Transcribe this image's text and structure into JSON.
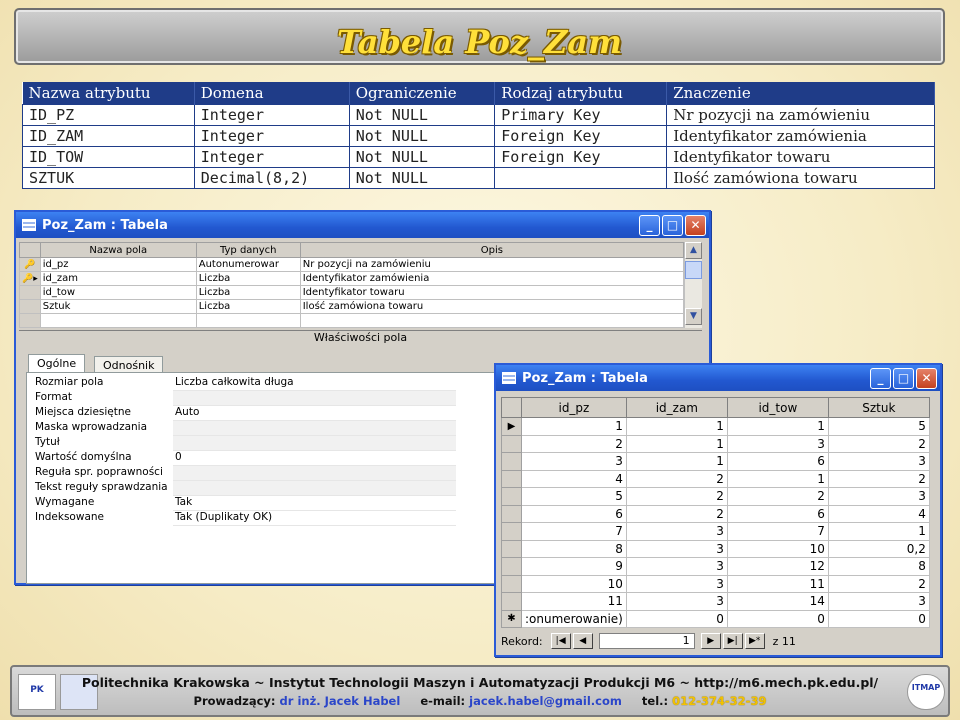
{
  "slide": {
    "title": "Tabela Poz_Zam"
  },
  "definition": {
    "headers": [
      "Nazwa atrybutu",
      "Domena",
      "Ograniczenie",
      "Rodzaj atrybutu",
      "Znaczenie"
    ],
    "rows": [
      [
        "ID_PZ",
        "Integer",
        "Not NULL",
        "Primary Key",
        "Nr pozycji na zamówieniu"
      ],
      [
        "ID_ZAM",
        "Integer",
        "Not NULL",
        "Foreign Key",
        "Identyfikator zamówienia"
      ],
      [
        "ID_TOW",
        "Integer",
        "Not NULL",
        "Foreign Key",
        "Identyfikator towaru"
      ],
      [
        "SZTUK",
        "Decimal(8,2)",
        "Not NULL",
        "",
        "Ilość zamówiona towaru"
      ]
    ]
  },
  "design_window": {
    "title": "Poz_Zam : Tabela",
    "headers": [
      "Nazwa pola",
      "Typ danych",
      "Opis"
    ],
    "rows": [
      {
        "marker": "🔑",
        "name": "id_pz",
        "type": "Autonumerowar",
        "desc": "Nr pozycji na zamówieniu"
      },
      {
        "marker": "🔑▸",
        "name": "id_zam",
        "type": "Liczba",
        "desc": "Identyfikator zamówienia"
      },
      {
        "marker": "",
        "name": "id_tow",
        "type": "Liczba",
        "desc": "Identyfikator towaru"
      },
      {
        "marker": "",
        "name": "Sztuk",
        "type": "Liczba",
        "desc": "Ilość zamówiona towaru"
      },
      {
        "marker": "",
        "name": "",
        "type": "",
        "desc": ""
      }
    ],
    "properties_label": "Właściwości pola",
    "tabs": [
      "Ogólne",
      "Odnośnik"
    ],
    "properties": [
      {
        "k": "Rozmiar pola",
        "v": "Liczba całkowita długa"
      },
      {
        "k": "Format",
        "v": ""
      },
      {
        "k": "Miejsca dziesiętne",
        "v": "Auto"
      },
      {
        "k": "Maska wprowadzania",
        "v": ""
      },
      {
        "k": "Tytuł",
        "v": ""
      },
      {
        "k": "Wartość domyślna",
        "v": "0"
      },
      {
        "k": "Reguła spr. poprawności",
        "v": ""
      },
      {
        "k": "Tekst reguły sprawdzania",
        "v": ""
      },
      {
        "k": "Wymagane",
        "v": "Tak"
      },
      {
        "k": "Indeksowane",
        "v": "Tak (Duplikaty OK)"
      }
    ]
  },
  "data_window": {
    "title": "Poz_Zam : Tabela",
    "headers": [
      "id_pz",
      "id_zam",
      "id_tow",
      "Sztuk"
    ],
    "rows": [
      [
        "1",
        "1",
        "1",
        "5"
      ],
      [
        "2",
        "1",
        "3",
        "2"
      ],
      [
        "3",
        "1",
        "6",
        "3"
      ],
      [
        "4",
        "2",
        "1",
        "2"
      ],
      [
        "5",
        "2",
        "2",
        "3"
      ],
      [
        "6",
        "2",
        "6",
        "4"
      ],
      [
        "7",
        "3",
        "7",
        "1"
      ],
      [
        "8",
        "3",
        "10",
        "0,2"
      ],
      [
        "9",
        "3",
        "12",
        "8"
      ],
      [
        "10",
        "3",
        "11",
        "2"
      ],
      [
        "11",
        "3",
        "14",
        "3"
      ],
      [
        ":onumerowanie)",
        "0",
        "0",
        "0"
      ]
    ],
    "record_label": "Rekord:",
    "record_value": "1",
    "record_total": "z  11"
  },
  "footer": {
    "line1": "Politechnika Krakowska   ~   Instytut Technologii Maszyn i Automatyzacji Produkcji M6   ~   http://m6.mech.pk.edu.pl/",
    "lecturer_label": "Prowadzący:",
    "lecturer": "dr inż. Jacek Habel",
    "email_label": "e-mail:",
    "email": "jacek.habel@gmail.com",
    "phone_label": "tel.:",
    "phone": "012-374-32-39",
    "logo_left": "PK",
    "logo_right": "ITMAP"
  }
}
